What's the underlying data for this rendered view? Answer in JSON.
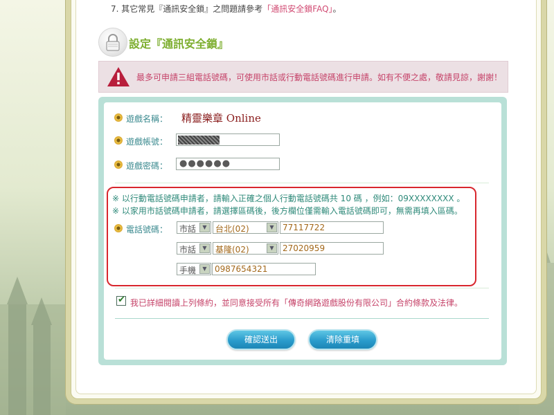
{
  "top_note": {
    "prefix": "7. 其它常見『通訊安全鎖』之問題請參考",
    "link": "「通訊安全鎖FAQ」",
    "suffix": "。"
  },
  "section": {
    "title": "設定『通訊安全鎖』"
  },
  "warning": {
    "text": "最多可申請三組電話號碼，可使用市話或行動電話號碼進行申請。如有不便之處，敬請見諒，謝謝！"
  },
  "form": {
    "game_name_label": "遊戲名稱：",
    "game_name_value": "精靈樂章 Online",
    "account_label": "遊戲帳號：",
    "password_label": "遊戲密碼：",
    "password_value": "●●●●●●",
    "hint_mobile": "※ 以行動電話號碼申請者，請輸入正確之個人行動電話號碼共 10 碼 ，例如：09XXXXXXXX 。",
    "hint_landline": "※ 以家用市話號碼申請者，請選擇區碼後，後方欄位僅需輸入電話號碼即可，無需再填入區碼。",
    "phone_label": "電話號碼：",
    "phones": [
      {
        "type": "市話",
        "area": "台北(02)",
        "number": "77117722"
      },
      {
        "type": "市話",
        "area": "基隆(02)",
        "number": "27020959"
      },
      {
        "type": "手機",
        "area": "",
        "number": "0987654321"
      }
    ],
    "agree_text": "我已詳細閱讀上列條約，並同意接受所有「傳奇網路遊戲股份有限公司」合約條款及法律。",
    "agree_checked": true
  },
  "buttons": {
    "submit": "確認送出",
    "reset": "清除重填"
  },
  "colors": {
    "accent_green": "#7dae2f",
    "warning_pink": "#c6446a",
    "panel_teal": "#b9e0d7",
    "button_blue": "#2a9ccc",
    "highlight_red": "#d8262d"
  }
}
